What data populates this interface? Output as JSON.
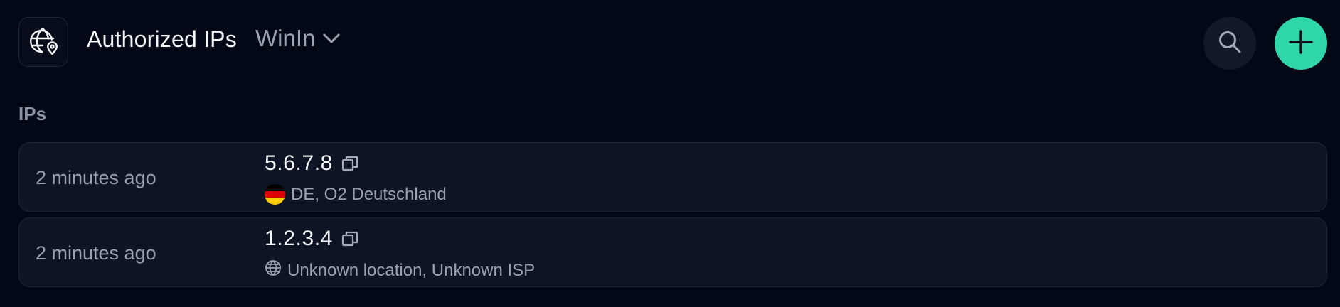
{
  "header": {
    "icon": "globe-location-icon",
    "title": "Authorized IPs",
    "workspace": "WinIn",
    "workspace_icon": "chevron-down-icon",
    "search_icon": "search-icon",
    "add_icon": "plus-icon",
    "accent_color": "#2fd7a8"
  },
  "section": {
    "label": "IPs"
  },
  "ips": [
    {
      "time": "2 minutes ago",
      "ip": "5.6.7.8",
      "location": "DE, O2 Deutschland",
      "location_icon": "germany-flag-icon"
    },
    {
      "time": "2 minutes ago",
      "ip": "1.2.3.4",
      "location": "Unknown location, Unknown ISP",
      "location_icon": "globe-icon"
    }
  ]
}
